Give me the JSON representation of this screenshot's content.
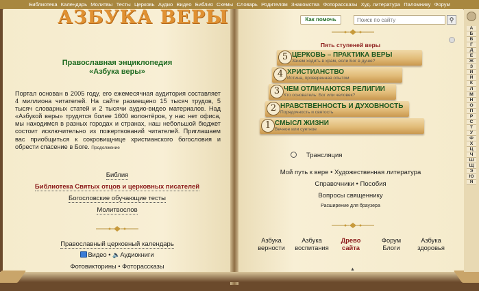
{
  "topnav": [
    "Библиотека",
    "Календарь",
    "Молитвы",
    "Тесты",
    "Церковь",
    "Аудио",
    "Видео",
    "Библия",
    "Схемы",
    "Словарь",
    "Родителям",
    "Знакомства",
    "Фоторассказы",
    "Худ. литература",
    "Паломнику",
    "Форум"
  ],
  "logo": "АЗБУКА ВЕРЫ",
  "encyclopedia": {
    "line1": "Православная энциклопедия",
    "line2": "«Азбука веры»"
  },
  "intro": {
    "text": "Портал основан в 2005 году, его ежемесячная аудитория составляет 4 миллиона читателей. На сайте размещено 15 тысяч трудов, 5 тысяч словарных статей и 2 тысячи аудио-видео материалов. Над «Азбукой веры» трудятся более 1600 волонтёров, у нас нет офиса, мы находимся в разных городах и странах, наш небольшой бюджет состоит исключительно из пожертвований читателей. Приглашаем вас приобщиться к сокровищнице христианского богословия и обрести спасение в Боге.",
    "more": "Продолжение"
  },
  "left_links": {
    "bible": "Библия",
    "library": "Библиотека Святых отцов и церковных писателей",
    "tests": "Богословские обучающие тесты",
    "prayerbook": "Молитвослов"
  },
  "calendar": "Православный церковный календарь",
  "media": {
    "video": "Видео",
    "sep": "•",
    "audio": "Аудиокниги"
  },
  "photo": {
    "quiz": "Фотовикторины",
    "sep": "•",
    "stories": "Фоторассказы"
  },
  "help_button": "Как помочь",
  "search_placeholder": "Поиск по сайту",
  "steps_title": "Пять ступеней веры",
  "steps": [
    {
      "n": "5",
      "title": "ЦЕРКОВЬ – ПРАКТИКА ВЕРЫ",
      "sub": "Зачем ходить в храм, если Бог в душе?"
    },
    {
      "n": "4",
      "title": "ХРИСТИАНСТВО",
      "sub": "Истина, проверенная опытом"
    },
    {
      "n": "3",
      "title": "ЧЕМ ОТЛИЧАЮТСЯ РЕЛИГИИ",
      "sub": "Кто основатель: Бог или человек?"
    },
    {
      "n": "2",
      "title": "НРАВСТВЕННОСТЬ И ДУХОВНОСТЬ",
      "sub": "Порядочность и святость"
    },
    {
      "n": "1",
      "title": "СМЫСЛ ЖИЗНИ",
      "sub": "Вечное или суетное"
    }
  ],
  "broadcast": "Трансляция",
  "right_links": {
    "path": "Мой путь к вере",
    "fiction": "Художественная литература",
    "references": "Справочники",
    "manuals": "Пособия",
    "questions": "Вопросы священнику",
    "extension": "Расширение для браузера",
    "sep": "•"
  },
  "bottom_books": [
    {
      "l1": "Азбука",
      "l2": "верности"
    },
    {
      "l1": "Азбука",
      "l2": "воспитания"
    },
    {
      "l1": "Древо",
      "l2": "сайта"
    },
    {
      "l1": "Форум",
      "l2": "Блоги"
    },
    {
      "l1": "Азбука",
      "l2": "здоровья"
    }
  ],
  "alphabet": [
    "А",
    "Б",
    "В",
    "Г",
    "Д",
    "Е",
    "Ж",
    "З",
    "И",
    "Й",
    "К",
    "Л",
    "М",
    "Н",
    "О",
    "П",
    "Р",
    "С",
    "Т",
    "У",
    "Ф",
    "Х",
    "Ц",
    "Ч",
    "Ш",
    "Щ",
    "Э",
    "Ю",
    "Я"
  ],
  "colors": {
    "nav": "#a8873f",
    "green": "#1f6b22",
    "red": "#8b1a1a",
    "logo": "#e09132"
  }
}
